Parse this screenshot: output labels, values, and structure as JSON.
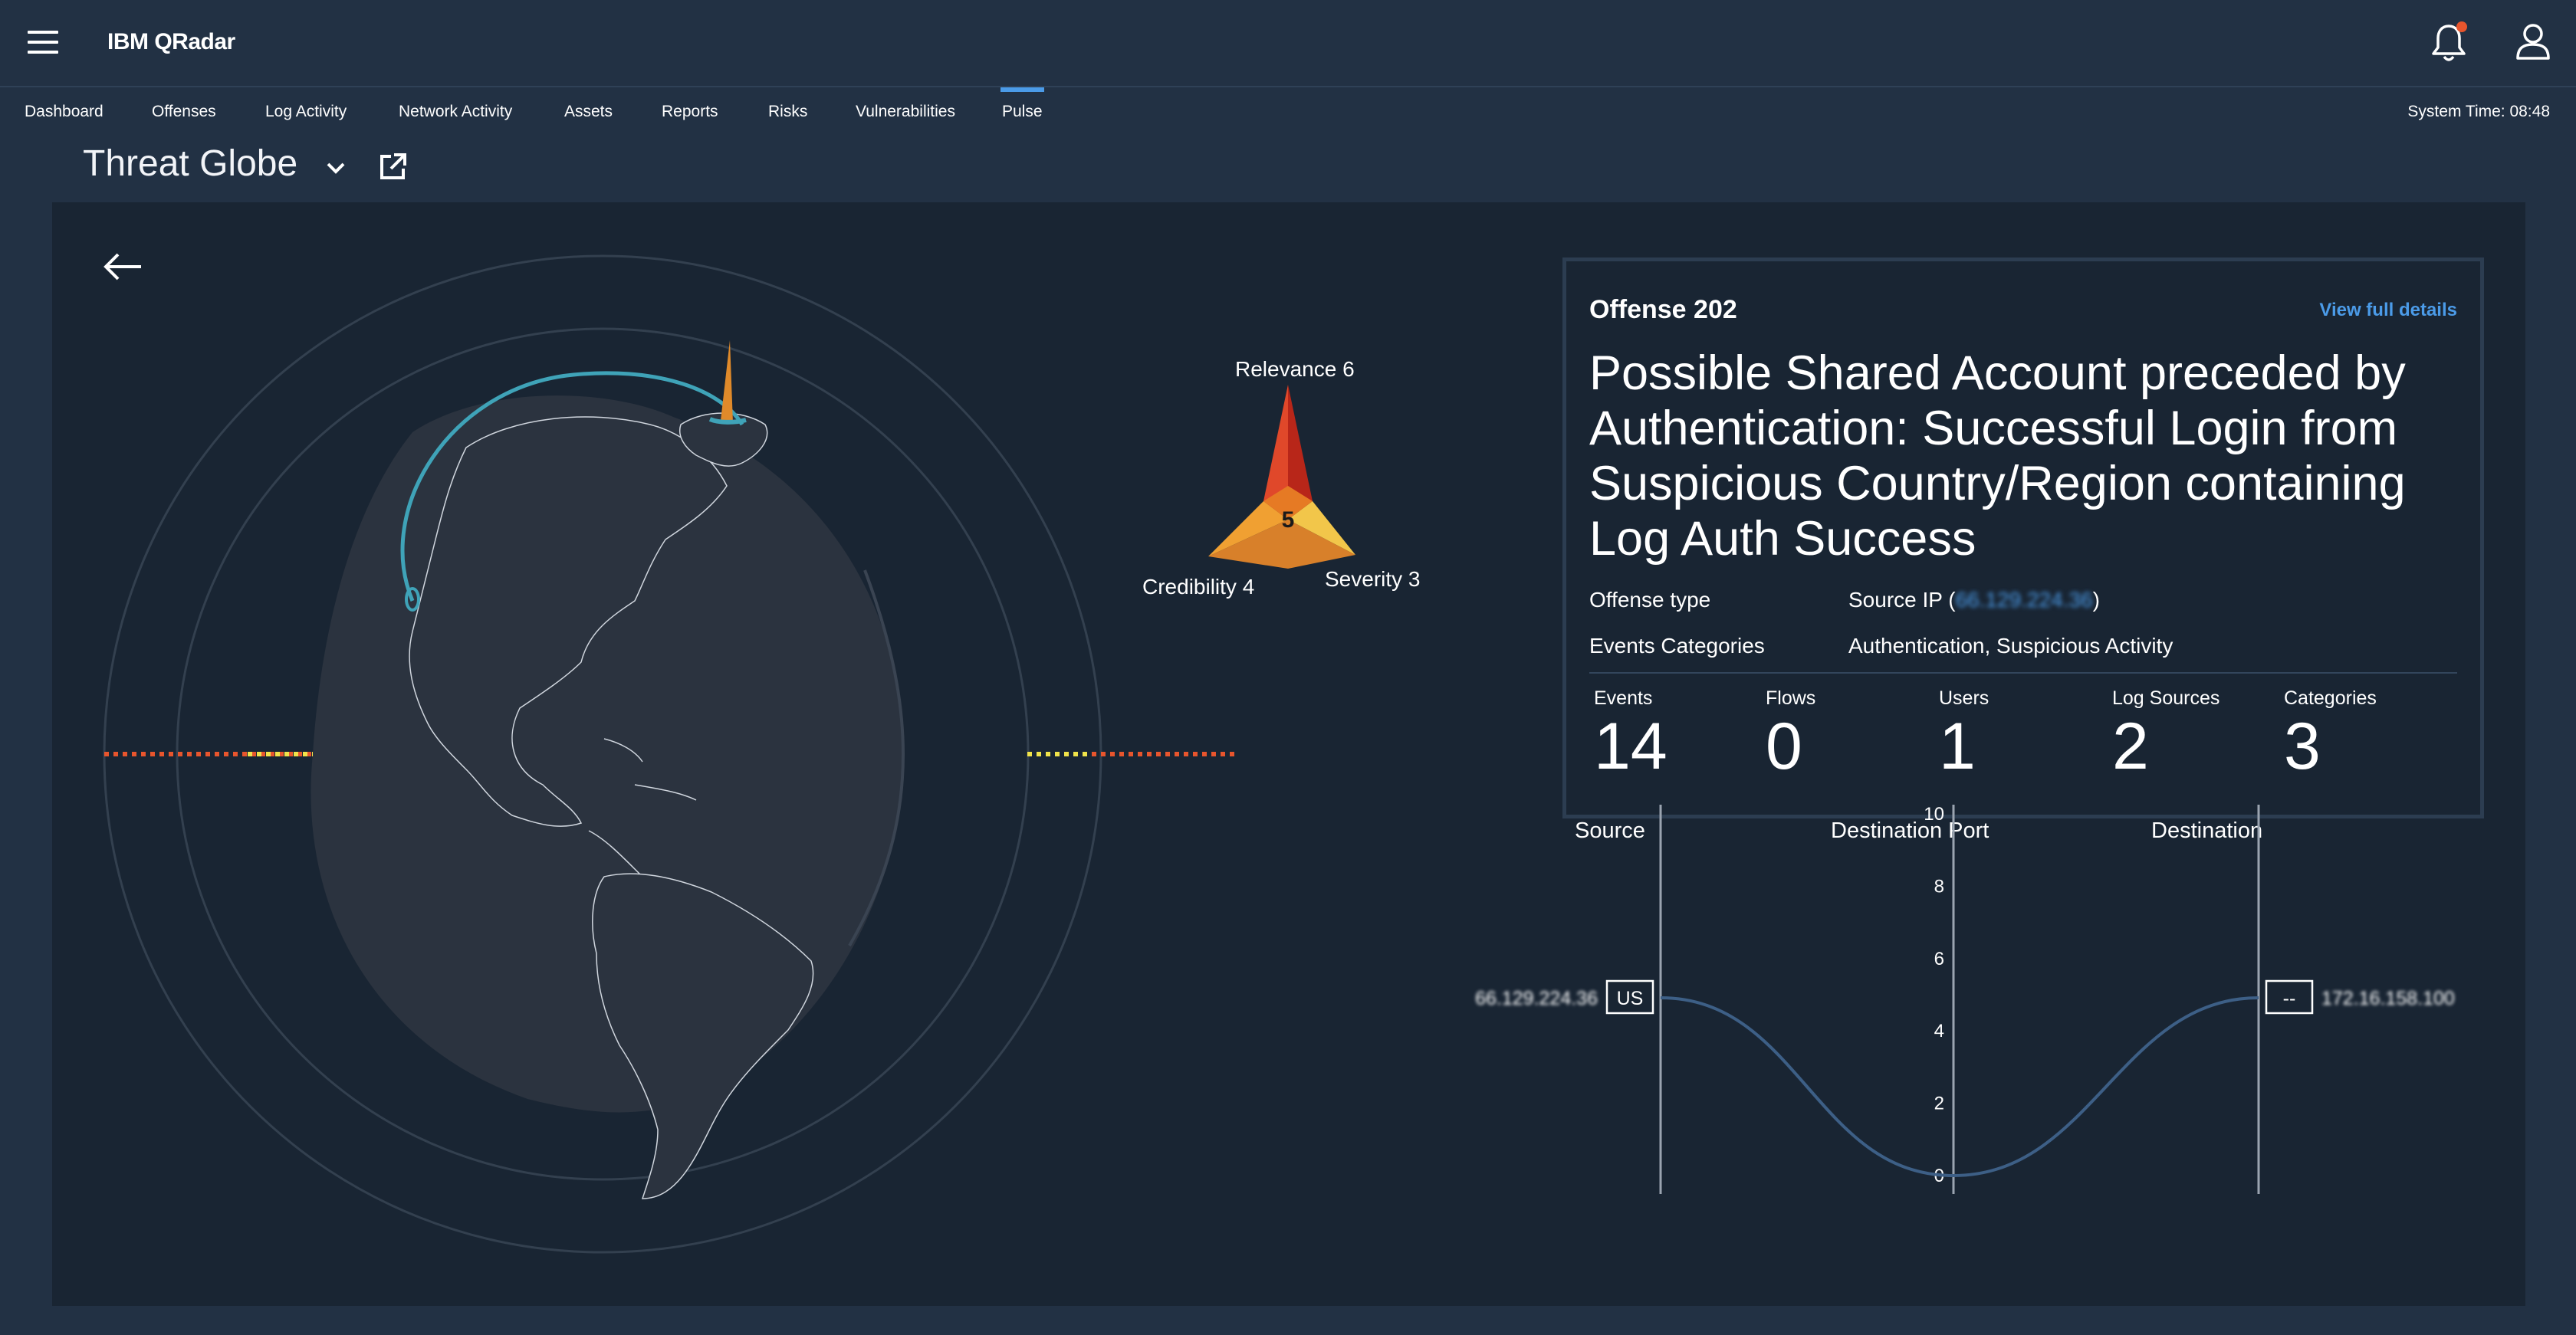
{
  "header": {
    "app_title": "IBM QRadar",
    "menu_icon": "hamburger-menu-icon",
    "notification_icon": "bell-icon",
    "user_icon": "user-icon"
  },
  "nav": {
    "items": [
      {
        "label": "Dashboard"
      },
      {
        "label": "Offenses"
      },
      {
        "label": "Log Activity"
      },
      {
        "label": "Network Activity"
      },
      {
        "label": "Assets"
      },
      {
        "label": "Reports"
      },
      {
        "label": "Risks"
      },
      {
        "label": "Vulnerabilities"
      },
      {
        "label": "Pulse"
      }
    ],
    "active": "Pulse",
    "system_time": "System Time: 08:48"
  },
  "page": {
    "title": "Threat Globe"
  },
  "magnitude": {
    "center_value": "5",
    "relevance_label": "Relevance 6",
    "severity_label": "Severity 3",
    "credibility_label": "Credibility 4"
  },
  "offense": {
    "id_label": "Offense 202",
    "view_details": "View full details",
    "title": "Possible Shared Account preceded by Authentication: Successful Login from Suspicious Country/Region containing Log Auth Success",
    "offense_type_label": "Offense type",
    "offense_type_prefix": "Source IP (",
    "offense_type_ip": "66.129.224.36",
    "offense_type_suffix": ")",
    "events_categories_label": "Events Categories",
    "events_categories_value": "Authentication, Suspicious Activity",
    "stats": [
      {
        "label": "Events",
        "value": "14"
      },
      {
        "label": "Flows",
        "value": "0"
      },
      {
        "label": "Users",
        "value": "1"
      },
      {
        "label": "Log Sources",
        "value": "2"
      },
      {
        "label": "Categories",
        "value": "3"
      }
    ]
  },
  "flow_chart": {
    "axes": [
      "Source",
      "Destination Port",
      "Destination"
    ],
    "source_ip": "66.129.224.36",
    "source_country": "US",
    "destination_country": "--",
    "destination_ip": "172.16.158.100",
    "port_ticks": [
      "0",
      "2",
      "4",
      "6",
      "8",
      "10"
    ],
    "port_range": [
      0,
      10
    ],
    "port_value": 0,
    "line_color": "#3d5f86"
  },
  "colors": {
    "background": "#223144",
    "panel": "#192533",
    "accent": "#4b9be8",
    "arc": "#3fa3b8"
  }
}
